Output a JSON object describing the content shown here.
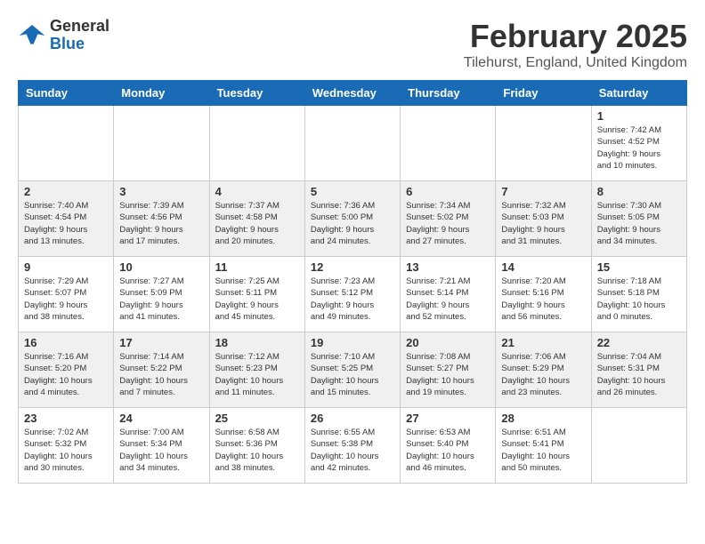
{
  "logo": {
    "line1": "General",
    "line2": "Blue"
  },
  "title": "February 2025",
  "subtitle": "Tilehurst, England, United Kingdom",
  "weekdays": [
    "Sunday",
    "Monday",
    "Tuesday",
    "Wednesday",
    "Thursday",
    "Friday",
    "Saturday"
  ],
  "weeks": [
    [
      {
        "day": "",
        "info": ""
      },
      {
        "day": "",
        "info": ""
      },
      {
        "day": "",
        "info": ""
      },
      {
        "day": "",
        "info": ""
      },
      {
        "day": "",
        "info": ""
      },
      {
        "day": "",
        "info": ""
      },
      {
        "day": "1",
        "info": "Sunrise: 7:42 AM\nSunset: 4:52 PM\nDaylight: 9 hours\nand 10 minutes."
      }
    ],
    [
      {
        "day": "2",
        "info": "Sunrise: 7:40 AM\nSunset: 4:54 PM\nDaylight: 9 hours\nand 13 minutes."
      },
      {
        "day": "3",
        "info": "Sunrise: 7:39 AM\nSunset: 4:56 PM\nDaylight: 9 hours\nand 17 minutes."
      },
      {
        "day": "4",
        "info": "Sunrise: 7:37 AM\nSunset: 4:58 PM\nDaylight: 9 hours\nand 20 minutes."
      },
      {
        "day": "5",
        "info": "Sunrise: 7:36 AM\nSunset: 5:00 PM\nDaylight: 9 hours\nand 24 minutes."
      },
      {
        "day": "6",
        "info": "Sunrise: 7:34 AM\nSunset: 5:02 PM\nDaylight: 9 hours\nand 27 minutes."
      },
      {
        "day": "7",
        "info": "Sunrise: 7:32 AM\nSunset: 5:03 PM\nDaylight: 9 hours\nand 31 minutes."
      },
      {
        "day": "8",
        "info": "Sunrise: 7:30 AM\nSunset: 5:05 PM\nDaylight: 9 hours\nand 34 minutes."
      }
    ],
    [
      {
        "day": "9",
        "info": "Sunrise: 7:29 AM\nSunset: 5:07 PM\nDaylight: 9 hours\nand 38 minutes."
      },
      {
        "day": "10",
        "info": "Sunrise: 7:27 AM\nSunset: 5:09 PM\nDaylight: 9 hours\nand 41 minutes."
      },
      {
        "day": "11",
        "info": "Sunrise: 7:25 AM\nSunset: 5:11 PM\nDaylight: 9 hours\nand 45 minutes."
      },
      {
        "day": "12",
        "info": "Sunrise: 7:23 AM\nSunset: 5:12 PM\nDaylight: 9 hours\nand 49 minutes."
      },
      {
        "day": "13",
        "info": "Sunrise: 7:21 AM\nSunset: 5:14 PM\nDaylight: 9 hours\nand 52 minutes."
      },
      {
        "day": "14",
        "info": "Sunrise: 7:20 AM\nSunset: 5:16 PM\nDaylight: 9 hours\nand 56 minutes."
      },
      {
        "day": "15",
        "info": "Sunrise: 7:18 AM\nSunset: 5:18 PM\nDaylight: 10 hours\nand 0 minutes."
      }
    ],
    [
      {
        "day": "16",
        "info": "Sunrise: 7:16 AM\nSunset: 5:20 PM\nDaylight: 10 hours\nand 4 minutes."
      },
      {
        "day": "17",
        "info": "Sunrise: 7:14 AM\nSunset: 5:22 PM\nDaylight: 10 hours\nand 7 minutes."
      },
      {
        "day": "18",
        "info": "Sunrise: 7:12 AM\nSunset: 5:23 PM\nDaylight: 10 hours\nand 11 minutes."
      },
      {
        "day": "19",
        "info": "Sunrise: 7:10 AM\nSunset: 5:25 PM\nDaylight: 10 hours\nand 15 minutes."
      },
      {
        "day": "20",
        "info": "Sunrise: 7:08 AM\nSunset: 5:27 PM\nDaylight: 10 hours\nand 19 minutes."
      },
      {
        "day": "21",
        "info": "Sunrise: 7:06 AM\nSunset: 5:29 PM\nDaylight: 10 hours\nand 23 minutes."
      },
      {
        "day": "22",
        "info": "Sunrise: 7:04 AM\nSunset: 5:31 PM\nDaylight: 10 hours\nand 26 minutes."
      }
    ],
    [
      {
        "day": "23",
        "info": "Sunrise: 7:02 AM\nSunset: 5:32 PM\nDaylight: 10 hours\nand 30 minutes."
      },
      {
        "day": "24",
        "info": "Sunrise: 7:00 AM\nSunset: 5:34 PM\nDaylight: 10 hours\nand 34 minutes."
      },
      {
        "day": "25",
        "info": "Sunrise: 6:58 AM\nSunset: 5:36 PM\nDaylight: 10 hours\nand 38 minutes."
      },
      {
        "day": "26",
        "info": "Sunrise: 6:55 AM\nSunset: 5:38 PM\nDaylight: 10 hours\nand 42 minutes."
      },
      {
        "day": "27",
        "info": "Sunrise: 6:53 AM\nSunset: 5:40 PM\nDaylight: 10 hours\nand 46 minutes."
      },
      {
        "day": "28",
        "info": "Sunrise: 6:51 AM\nSunset: 5:41 PM\nDaylight: 10 hours\nand 50 minutes."
      },
      {
        "day": "",
        "info": ""
      }
    ]
  ]
}
